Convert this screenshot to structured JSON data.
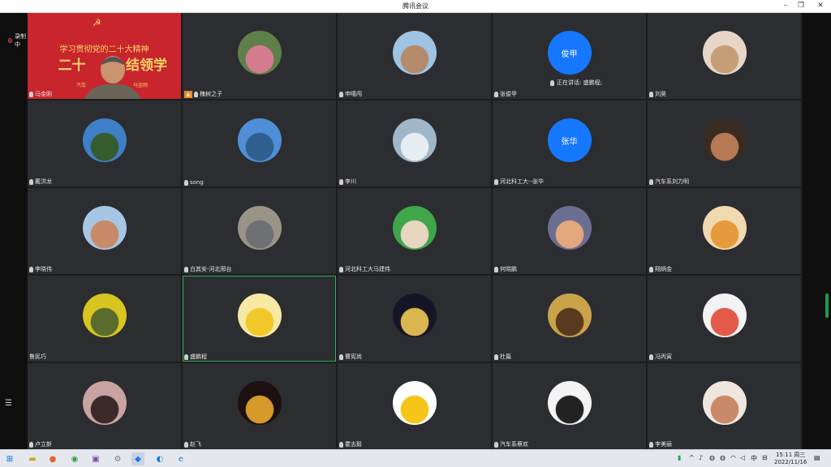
{
  "window": {
    "title": "腾讯会议"
  },
  "recording": {
    "label": "录制中"
  },
  "banner": {
    "line1": "学习贯彻党的二十大精神",
    "line2_left": "二十",
    "line2_right": "结领学",
    "line3_left": "汽车",
    "line3_right": "马金刚"
  },
  "speaking": {
    "label": "正在讲话: 盛鹏程;"
  },
  "participants": [
    {
      "name": "马金刚",
      "avatar": "video-feed"
    },
    {
      "name": "槐树之子",
      "avatar": "flower-photo"
    },
    {
      "name": "申嘻闯",
      "avatar": "selfie-photo"
    },
    {
      "name": "张俊甲",
      "avatar_text": "俊甲"
    },
    {
      "name": "刘昊",
      "avatar": "dog-photo"
    },
    {
      "name": "戴洪龙",
      "avatar": "tree-sky-photo"
    },
    {
      "name": "song",
      "avatar": "lake-photo"
    },
    {
      "name": "李川",
      "avatar": "clouds-photo"
    },
    {
      "name": "河北科工大--张华",
      "avatar_text": "张华"
    },
    {
      "name": "汽车系刘力明",
      "avatar": "man-photo"
    },
    {
      "name": "李晓伟",
      "avatar": "couple-photo"
    },
    {
      "name": "白其安-河北邢台",
      "avatar": "collage-photo"
    },
    {
      "name": "河北科工大马建伟",
      "avatar": "child-photo"
    },
    {
      "name": "何晓鹏",
      "avatar": "sunset-photo"
    },
    {
      "name": "翔炳金",
      "avatar": "tiger-cartoon"
    },
    {
      "name": "鲁民巧",
      "avatar": "person-yellow-photo"
    },
    {
      "name": "盛鹏程",
      "avatar": "duck-cartoon"
    },
    {
      "name": "曹宪尚",
      "avatar": "night-city-photo"
    },
    {
      "name": "杜篇",
      "avatar": "little-prince-photo"
    },
    {
      "name": "冯丙寅",
      "avatar": "boy-cartoon"
    },
    {
      "name": "卢立新",
      "avatar": "boy-glasses-cartoon"
    },
    {
      "name": "赵飞",
      "avatar": "night-building-photo"
    },
    {
      "name": "霍志毅",
      "avatar": "sun-icon"
    },
    {
      "name": "汽车系蔡欢",
      "avatar": "portrait-photo"
    },
    {
      "name": "李美丽",
      "avatar": "cartoon-girl"
    }
  ],
  "taskbar": {
    "clock_time": "15:11 周三",
    "clock_date": "2022/11/16",
    "ime": "中"
  },
  "colors": {
    "accent": "#1677ff",
    "active_border": "#2db35d",
    "tile": "#2c2d30"
  }
}
